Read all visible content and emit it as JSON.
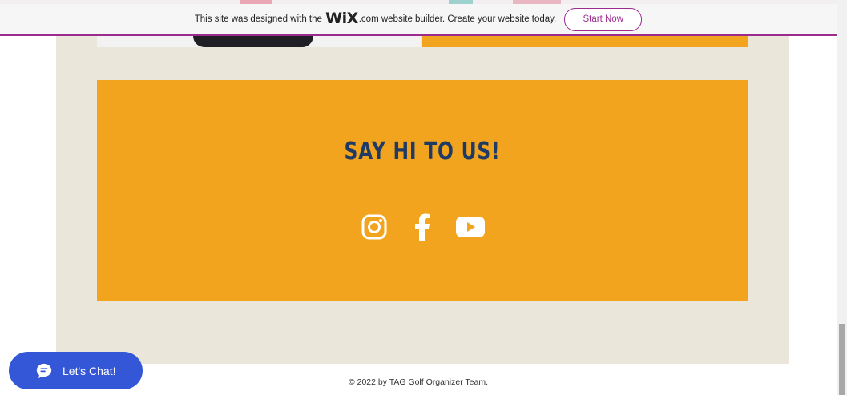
{
  "banner": {
    "text_before": "This site was designed with the",
    "logo": "WiX",
    "text_after": ".com website builder. Create your website today.",
    "start_label": "Start Now"
  },
  "section": {
    "heading": "SAY HI TO US!",
    "social_icons": [
      "instagram-icon",
      "facebook-icon",
      "youtube-icon"
    ]
  },
  "chat": {
    "label": "Let's Chat!"
  },
  "footer": {
    "copyright": "© 2022 by TAG Golf Organizer Team."
  },
  "colors": {
    "accent": "#f2a41f",
    "heading": "#1f3a63",
    "page_bg": "#ebe6da",
    "wix_purple": "#9c2b8e",
    "chat_blue": "#3357d6"
  }
}
